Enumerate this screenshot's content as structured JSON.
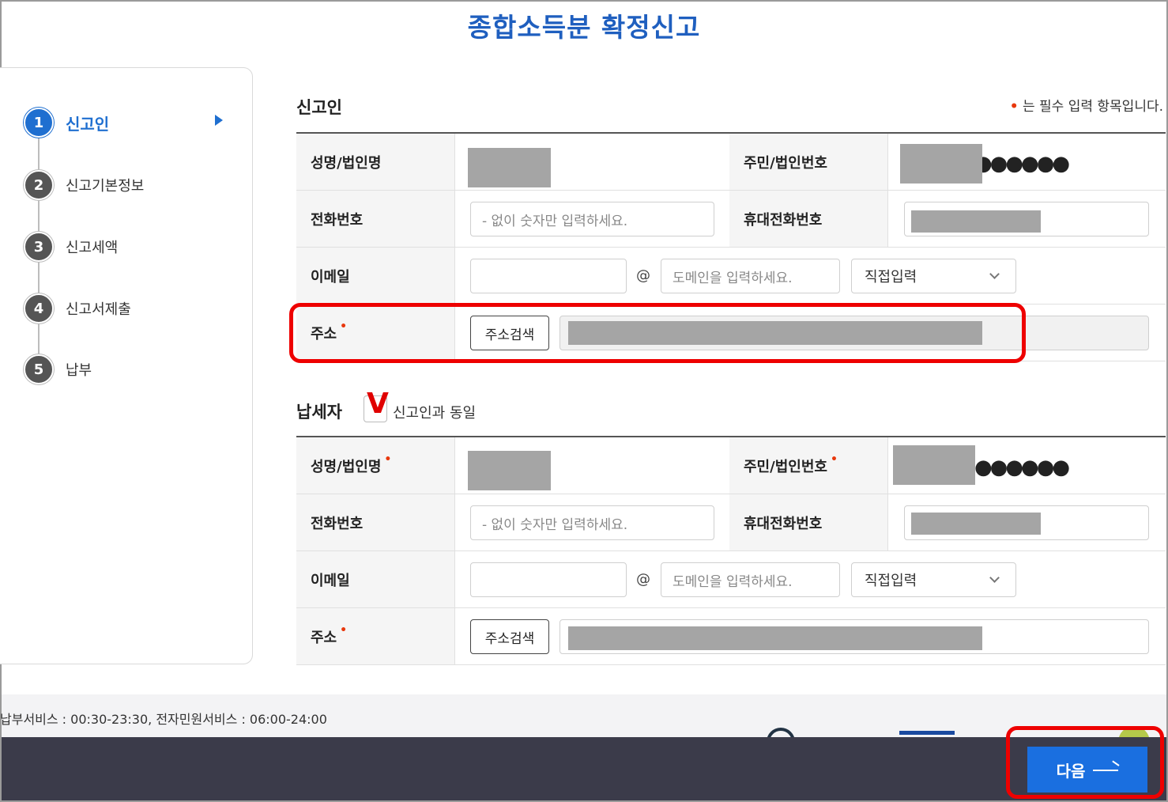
{
  "page": {
    "title": "종합소득분 확정신고"
  },
  "sidebar": {
    "steps": [
      {
        "num": "1",
        "label": "신고인"
      },
      {
        "num": "2",
        "label": "신고기본정보"
      },
      {
        "num": "3",
        "label": "신고세액"
      },
      {
        "num": "4",
        "label": "신고서제출"
      },
      {
        "num": "5",
        "label": "납부"
      }
    ]
  },
  "reporter": {
    "section_title": "신고인",
    "required_note": "는 필수 입력 항목입니다.",
    "name_label": "성명/법인명",
    "id_label": "주민/법인번호",
    "id_mask": "●●●●●●",
    "phone_label": "전화번호",
    "phone_placeholder": "- 없이 숫자만 입력하세요.",
    "mobile_label": "휴대전화번호",
    "email_label": "이메일",
    "email_at": "@",
    "domain_placeholder": "도메인을 입력하세요.",
    "domain_select": "직접입력",
    "address_label": "주소",
    "address_search": "주소검색"
  },
  "taxpayer": {
    "section_title": "납세자",
    "same_check_mark": "V",
    "same_label": "신고인과 동일",
    "name_label": "성명/법인명",
    "id_label": "주민/법인번호",
    "id_mask": "●●●●●●",
    "phone_label": "전화번호",
    "phone_placeholder": "- 없이 숫자만 입력하세요.",
    "mobile_label": "휴대전화번호",
    "email_label": "이메일",
    "email_at": "@",
    "domain_placeholder": "도메인을 입력하세요.",
    "domain_select": "직접입력",
    "address_label": "주소",
    "address_search": "주소검색"
  },
  "footer": {
    "service_hours": "납부서비스 : 00:30-23:30, 전자민원서비스 : 06:00-24:00"
  },
  "actions": {
    "next_label": "다음"
  },
  "colors": {
    "accent": "#1f6fd0",
    "required": "#e8380d",
    "highlight": "#ee0000",
    "bottom_bar": "#3b3b4a"
  }
}
